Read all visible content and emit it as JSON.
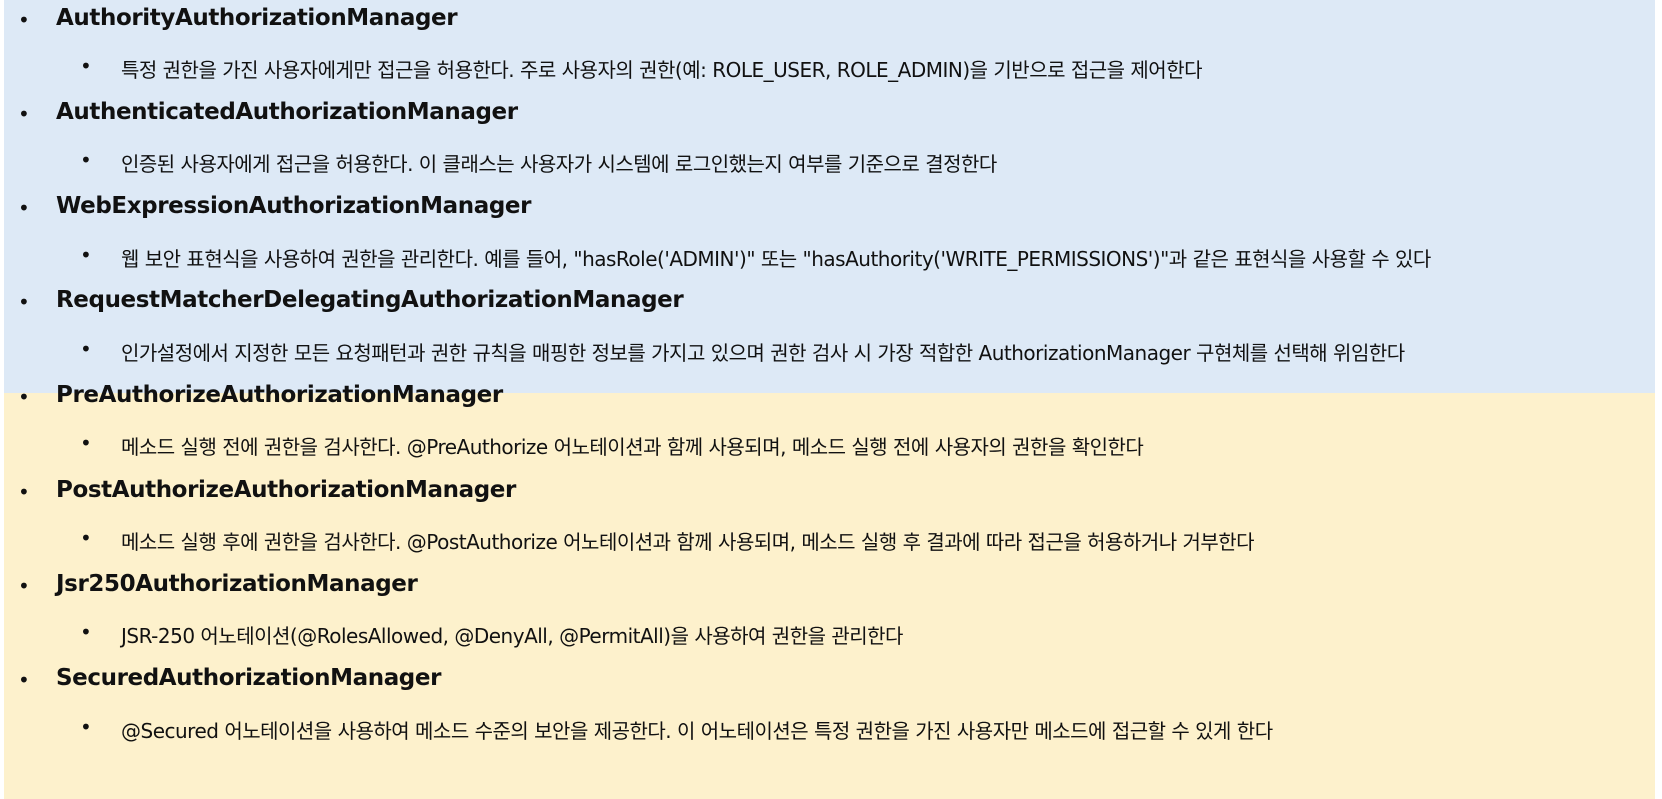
{
  "colors": {
    "section_blue": "#dde9f6",
    "section_yellow": "#fdf1cc"
  },
  "bullet_glyph": "•",
  "items": [
    {
      "title": "AuthorityAuthorizationManager",
      "desc": "특정 권한을 가진 사용자에게만 접근을 허용한다. 주로 사용자의 권한(예: ROLE_USER, ROLE_ADMIN)을 기반으로 접근을 제어한다"
    },
    {
      "title": "AuthenticatedAuthorizationManager",
      "desc": "인증된 사용자에게 접근을 허용한다. 이 클래스는 사용자가 시스템에 로그인했는지 여부를 기준으로 결정한다"
    },
    {
      "title": "WebExpressionAuthorizationManager",
      "desc": "웹 보안 표현식을 사용하여 권한을 관리한다. 예를 들어, \"hasRole('ADMIN')\" 또는 \"hasAuthority('WRITE_PERMISSIONS')\"과 같은 표현식을 사용할 수 있다"
    },
    {
      "title": "RequestMatcherDelegatingAuthorizationManager",
      "desc": "인가설정에서 지정한 모든 요청패턴과 권한 규칙을 매핑한 정보를 가지고 있으며 권한 검사 시 가장 적합한 AuthorizationManager 구현체를 선택해 위임한다"
    },
    {
      "title": "PreAuthorizeAuthorizationManager",
      "desc": "메소드 실행 전에 권한을 검사한다. @PreAuthorize 어노테이션과 함께 사용되며, 메소드 실행 전에 사용자의 권한을 확인한다"
    },
    {
      "title": "PostAuthorizeAuthorizationManager",
      "desc": "메소드 실행 후에 권한을 검사한다. @PostAuthorize 어노테이션과 함께 사용되며, 메소드 실행 후 결과에 따라 접근을 허용하거나 거부한다"
    },
    {
      "title": "Jsr250AuthorizationManager",
      "desc": "JSR-250 어노테이션(@RolesAllowed, @DenyAll, @PermitAll)을 사용하여 권한을 관리한다"
    },
    {
      "title": "SecuredAuthorizationManager",
      "desc": "@Secured 어노테이션을 사용하여 메소드 수준의 보안을 제공한다. 이 어노테이션은 특정 권한을 가진 사용자만 메소드에 접근할 수 있게 한다"
    }
  ]
}
